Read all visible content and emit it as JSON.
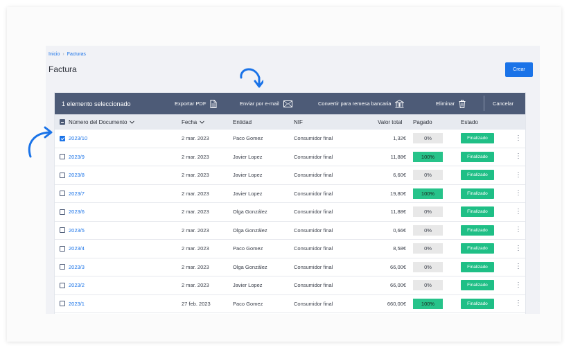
{
  "breadcrumb": {
    "home": "Inicio",
    "separator": "›",
    "current": "Facturas"
  },
  "page": {
    "title": "Factura",
    "create_label": "Crear"
  },
  "actionbar": {
    "selected_text": "1 elemento seleccionado",
    "export_pdf": "Exportar PDF",
    "send_email": "Enviar por e-mail",
    "convert_remittance": "Convertir para remesa bancaria",
    "delete": "Eliminar",
    "cancel": "Cancelar"
  },
  "columns": {
    "document": "Número del Documento",
    "date": "Fecha",
    "entity": "Entidad",
    "nif": "NIF",
    "total": "Valor total",
    "paid": "Pagado",
    "status": "Estado"
  },
  "rows": [
    {
      "doc": "2023/10",
      "date": "2 mar. 2023",
      "entity": "Paco Gomez",
      "nif": "Consumidor final",
      "total": "1,32€",
      "paid": "0%",
      "status": "Finalizado",
      "checked": true
    },
    {
      "doc": "2023/9",
      "date": "2 mar. 2023",
      "entity": "Javier Lopez",
      "nif": "Consumidor final",
      "total": "11,88€",
      "paid": "100%",
      "status": "Finalizado",
      "checked": false
    },
    {
      "doc": "2023/8",
      "date": "2 mar. 2023",
      "entity": "Javier Lopez",
      "nif": "Consumidor final",
      "total": "6,60€",
      "paid": "0%",
      "status": "Finalizado",
      "checked": false
    },
    {
      "doc": "2023/7",
      "date": "2 mar. 2023",
      "entity": "Javier Lopez",
      "nif": "Consumidor final",
      "total": "19,80€",
      "paid": "100%",
      "status": "Finalizado",
      "checked": false
    },
    {
      "doc": "2023/6",
      "date": "2 mar. 2023",
      "entity": "Olga González",
      "nif": "Consumidor final",
      "total": "11,88€",
      "paid": "0%",
      "status": "Finalizado",
      "checked": false
    },
    {
      "doc": "2023/5",
      "date": "2 mar. 2023",
      "entity": "Olga González",
      "nif": "Consumidor final",
      "total": "0,66€",
      "paid": "0%",
      "status": "Finalizado",
      "checked": false
    },
    {
      "doc": "2023/4",
      "date": "2 mar. 2023",
      "entity": "Paco Gomez",
      "nif": "Consumidor final",
      "total": "8,58€",
      "paid": "0%",
      "status": "Finalizado",
      "checked": false
    },
    {
      "doc": "2023/3",
      "date": "2 mar. 2023",
      "entity": "Olga González",
      "nif": "Consumidor final",
      "total": "66,00€",
      "paid": "0%",
      "status": "Finalizado",
      "checked": false
    },
    {
      "doc": "2023/2",
      "date": "2 mar. 2023",
      "entity": "Javier Lopez",
      "nif": "Consumidor final",
      "total": "66,00€",
      "paid": "0%",
      "status": "Finalizado",
      "checked": false
    },
    {
      "doc": "2023/1",
      "date": "27 feb. 2023",
      "entity": "Paco Gomez",
      "nif": "Consumidor final",
      "total": "660,00€",
      "paid": "100%",
      "status": "Finalizado",
      "checked": false
    }
  ],
  "icons": {
    "export_pdf": "document-icon",
    "send_email": "envelope-icon",
    "convert_remittance": "bank-icon",
    "delete": "trash-icon",
    "sort": "chevron-down-icon",
    "row_menu": "more-vertical-icon",
    "annotation": "curved-arrow-icon"
  },
  "colors": {
    "accent": "#1a73e8",
    "actionbar": "#4d5b77",
    "status_finalizado": "#1fbf86",
    "paid_full": "#27c38a",
    "paid_none": "#e8e8e8",
    "annotation_arrow": "#1a73e8"
  }
}
